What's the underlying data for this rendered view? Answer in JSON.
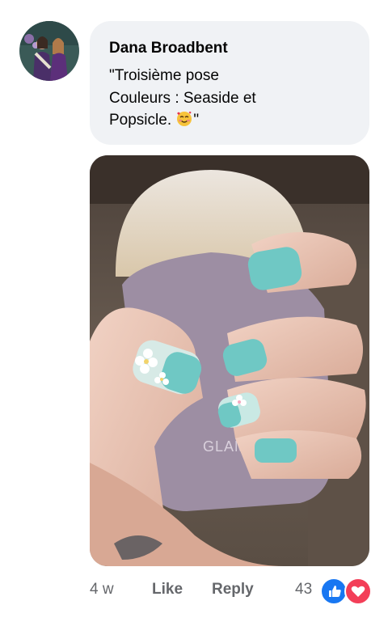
{
  "comment": {
    "author": "Dana Broadbent",
    "lines": [
      "\"Troisième pose",
      "Couleurs : Seaside et",
      "Popsicle. "
    ],
    "trailing_quote": "\"",
    "emoji": "smiling-face-with-hearts"
  },
  "photo": {
    "brand_text": "GLAMPDIP"
  },
  "footer": {
    "timestamp": "4 w",
    "like_label": "Like",
    "reply_label": "Reply",
    "reaction_count": "43",
    "reactions": [
      "like-icon",
      "love-icon"
    ]
  },
  "colors": {
    "bubble": "#f0f2f5",
    "meta_text": "#65676b",
    "like_blue": "#1877f2",
    "love_red": "#f33e58",
    "nail_teal": "#6fc8c4"
  }
}
